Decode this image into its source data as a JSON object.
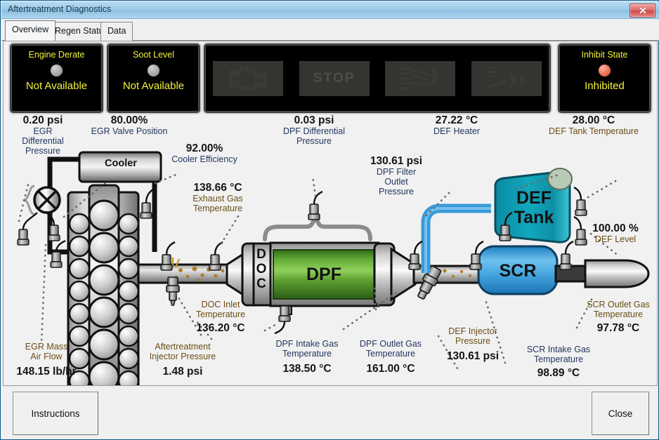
{
  "window": {
    "title": "Aftertreatment Diagnostics",
    "close_icon": "close-icon"
  },
  "tabs": [
    {
      "label": "Overview",
      "active": true
    },
    {
      "label": "Regen Status",
      "active": false
    },
    {
      "label": "Data",
      "active": false
    }
  ],
  "status_panels": [
    {
      "title": "Engine Derate",
      "value": "Not Available",
      "lamp": "grey"
    },
    {
      "title": "Soot Level",
      "value": "Not Available",
      "lamp": "grey"
    },
    {
      "title": "Inhibit State",
      "value": "Inhibited",
      "lamp": "red"
    }
  ],
  "telltales": [
    {
      "name": "check-engine-icon",
      "label": ""
    },
    {
      "name": "stop-icon",
      "label": "STOP"
    },
    {
      "name": "dpf-regen-icon",
      "label": ""
    },
    {
      "name": "hest-icon",
      "label": ""
    }
  ],
  "readouts": {
    "egr_differential_pressure": {
      "value": "0.20 psi",
      "label": "EGR\nDifferential\nPressure",
      "color": "navy"
    },
    "egr_valve_position": {
      "value": "80.00%",
      "label": "EGR Valve Position",
      "color": "navy"
    },
    "cooler_efficiency": {
      "value": "92.00%",
      "label": "Cooler Efficiency",
      "color": "navy"
    },
    "exhaust_gas_temperature": {
      "value": "138.66 °C",
      "label": "Exhaust Gas\nTemperature",
      "color": "olive"
    },
    "dpf_differential_pressure": {
      "value": "0.03 psi",
      "label": "DPF Differential\nPressure",
      "color": "navy"
    },
    "dpf_filter_outlet_pressure": {
      "value": "130.61 psi",
      "label": "DPF Filter\nOutlet\nPressure",
      "color": "navy"
    },
    "def_heater": {
      "value": "27.22 °C",
      "label": "DEF Heater",
      "color": "navy"
    },
    "def_tank_temperature": {
      "value": "28.00 °C",
      "label": "DEF Tank Temperature",
      "color": "olive"
    },
    "def_level": {
      "value": "100.00 %",
      "label": "DEF Level",
      "color": "olive"
    },
    "egr_mass_air_flow": {
      "value": "148.15 lb/hr",
      "label": "EGR Mass\nAir Flow",
      "color": "olive"
    },
    "aftertreatment_injector_pressure": {
      "value": "1.48 psi",
      "label": "Aftertreatment\nInjector Pressure",
      "color": "olive"
    },
    "doc_inlet_temperature": {
      "value": "136.20 °C",
      "label": "DOC Inlet\nTemperature",
      "color": "olive"
    },
    "dpf_intake_gas_temperature": {
      "value": "138.50 °C",
      "label": "DPF Intake Gas\nTemperature",
      "color": "navy"
    },
    "dpf_outlet_gas_temperature": {
      "value": "161.00 °C",
      "label": "DPF Outlet Gas\nTemperature",
      "color": "navy"
    },
    "def_injector_pressure": {
      "value": "130.61 psi",
      "label": "DEF Injector\nPressure",
      "color": "olive"
    },
    "scr_intake_gas_temperature": {
      "value": "98.89 °C",
      "label": "SCR Intake Gas\nTemperature",
      "color": "navy"
    },
    "scr_outlet_gas_temperature": {
      "value": "97.78 °C",
      "label": "SCR Outlet Gas\nTemperature",
      "color": "olive"
    }
  },
  "diagram_labels": {
    "cooler": "Cooler",
    "doc": "DOC",
    "dpf": "DPF",
    "def_tank_line1": "DEF",
    "def_tank_line2": "Tank",
    "scr": "SCR"
  },
  "buttons": {
    "instructions": "Instructions",
    "close": "Close"
  },
  "colors": {
    "lamp_text": "#f3f33a",
    "label_navy": "#22355f",
    "label_olive": "#6b4d14",
    "dpf_green": "#4f9a2a",
    "def_teal": "#109bb0",
    "scr_blue": "#3ea3dd",
    "def_line_blue": "#3a9ad9"
  }
}
